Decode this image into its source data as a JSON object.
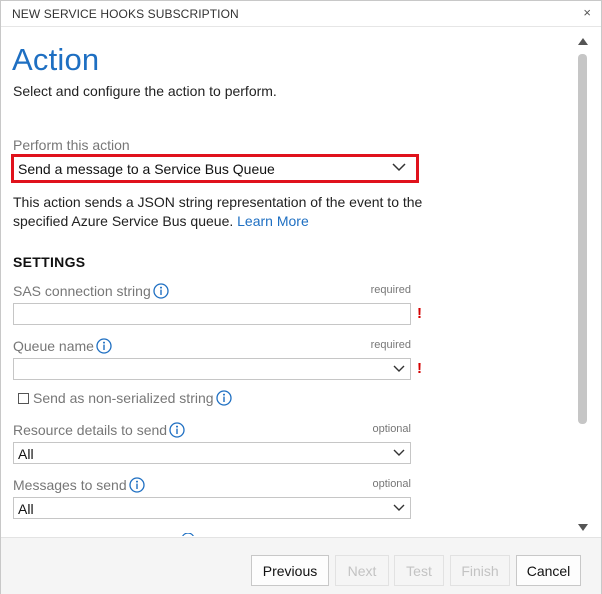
{
  "dialog": {
    "title": "NEW SERVICE HOOKS SUBSCRIPTION",
    "close_glyph": "×"
  },
  "header": {
    "heading": "Action",
    "subheading": "Select and configure the action to perform."
  },
  "action": {
    "label": "Perform this action",
    "selected": "Send a message to a Service Bus Queue",
    "description": "This action sends a JSON string representation of the event to the specified Azure Service Bus queue.",
    "learn_more": "Learn More"
  },
  "settings": {
    "title": "SETTINGS",
    "sas": {
      "label": "SAS connection string",
      "requirement": "required",
      "value": "",
      "error_glyph": "!"
    },
    "queue": {
      "label": "Queue name",
      "requirement": "required",
      "value": "",
      "error_glyph": "!"
    },
    "non_serialized": {
      "label": "Send as non-serialized string",
      "checked": false
    },
    "resource_details": {
      "label": "Resource details to send",
      "requirement": "optional",
      "value": "All"
    },
    "messages": {
      "label": "Messages to send",
      "requirement": "optional",
      "value": "All"
    }
  },
  "footer": {
    "previous": "Previous",
    "next": "Next",
    "test": "Test",
    "finish": "Finish",
    "cancel": "Cancel"
  },
  "icons": {
    "info": "info-icon",
    "chevron": "chevron-down-icon",
    "close": "close-icon"
  },
  "colors": {
    "accent": "#1e6fc2",
    "highlight_border": "#e0121c",
    "error": "#d40000",
    "muted_text": "#777777"
  }
}
